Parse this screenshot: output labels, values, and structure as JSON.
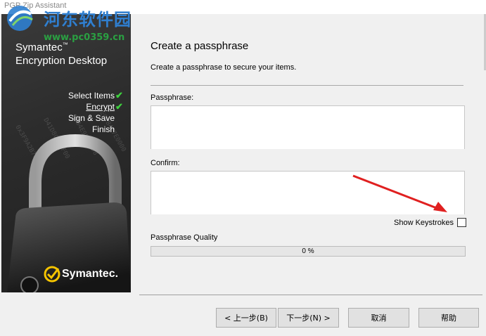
{
  "window": {
    "title": "PGP Zip Assistant"
  },
  "watermark": {
    "title": "河东软件园",
    "url": "www.pc0359.cn"
  },
  "sidebar": {
    "brand_line1": "Symantec",
    "brand_tm": "™",
    "brand_line2": "Encryption Desktop",
    "steps": [
      {
        "label": "Select Items",
        "done": true
      },
      {
        "label": "Encrypt",
        "done": true,
        "current": true
      },
      {
        "label": "Sign & Save",
        "done": false
      },
      {
        "label": "Finish",
        "done": false
      }
    ],
    "logo_text": "Symantec."
  },
  "main": {
    "heading": "Create a passphrase",
    "subtext": "Create a passphrase to secure your items.",
    "passphrase_label": "Passphrase:",
    "passphrase_value": "",
    "confirm_label": "Confirm:",
    "confirm_value": "",
    "show_keystrokes_label": "Show Keystrokes",
    "show_keystrokes_checked": false,
    "quality_label": "Passphrase Quality",
    "quality_percent": 0,
    "quality_text": "0 %"
  },
  "buttons": {
    "back": "< 上一步(B)",
    "next": "下一步(N) >",
    "cancel": "取消",
    "help": "帮助"
  },
  "colors": {
    "accent_arrow": "#e02020",
    "check": "#3ed13e",
    "progress_fill": "#06b025"
  }
}
